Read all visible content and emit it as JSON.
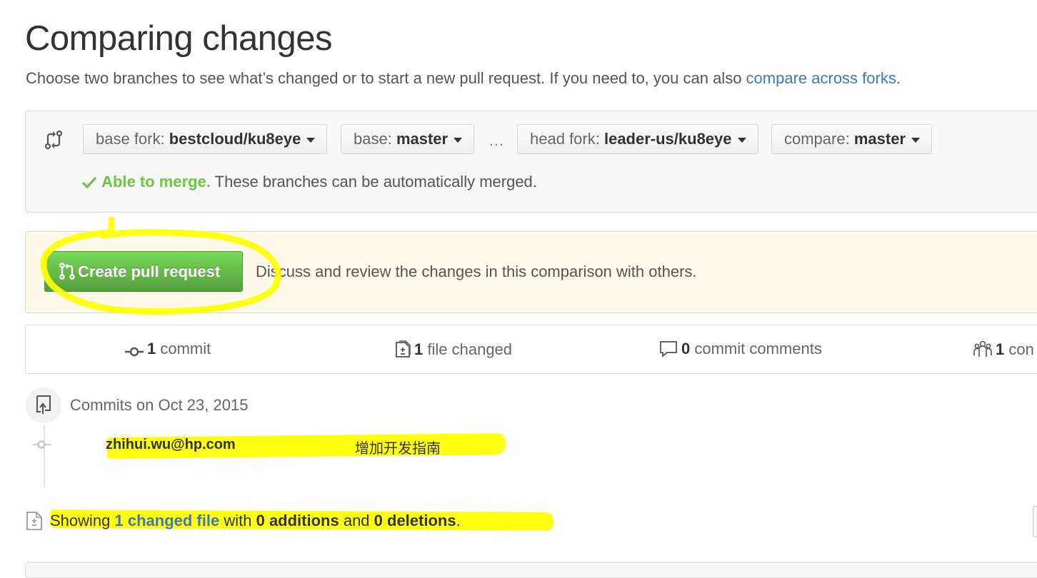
{
  "header": {
    "title": "Comparing changes",
    "subtitle": "Choose two branches to see what’s changed or to start a new pull request. If you need to, you can also ",
    "subtitle_link": "compare across forks",
    "subtitle_end": "."
  },
  "range": {
    "base_fork_label": "base fork:",
    "base_fork_value": "bestcloud/ku8eye",
    "base_label": "base:",
    "base_value": "master",
    "ellipsis": "…",
    "head_fork_label": "head fork:",
    "head_fork_value": "leader-us/ku8eye",
    "compare_label": "compare:",
    "compare_value": "master",
    "merge_ok": "Able to merge.",
    "merge_text": "These branches can be automatically merged."
  },
  "pull_request": {
    "button_label": "Create pull request",
    "description": "Discuss and review the changes in this comparison with others."
  },
  "summary": {
    "commits_count": "1",
    "commits_label": "commit",
    "files_count": "1",
    "files_label": "file changed",
    "comments_count": "0",
    "comments_label": "commit comments",
    "contributors_count": "1",
    "contributors_label": "con"
  },
  "commits": {
    "date_heading": "Commits on Oct 23, 2015",
    "items": [
      {
        "author": "zhihui.wu@hp.com",
        "message": "增加开发指南"
      }
    ]
  },
  "files": {
    "prefix": "Showing ",
    "link": "1 changed file",
    "middle": " with ",
    "additions": "0 additions",
    "and": " and ",
    "deletions": "0 deletions",
    "end": "."
  },
  "colors": {
    "link": "#4078c0",
    "merge_ok": "#6cc644",
    "button_green": "#6cc644",
    "highlighter": "#ffff00"
  }
}
